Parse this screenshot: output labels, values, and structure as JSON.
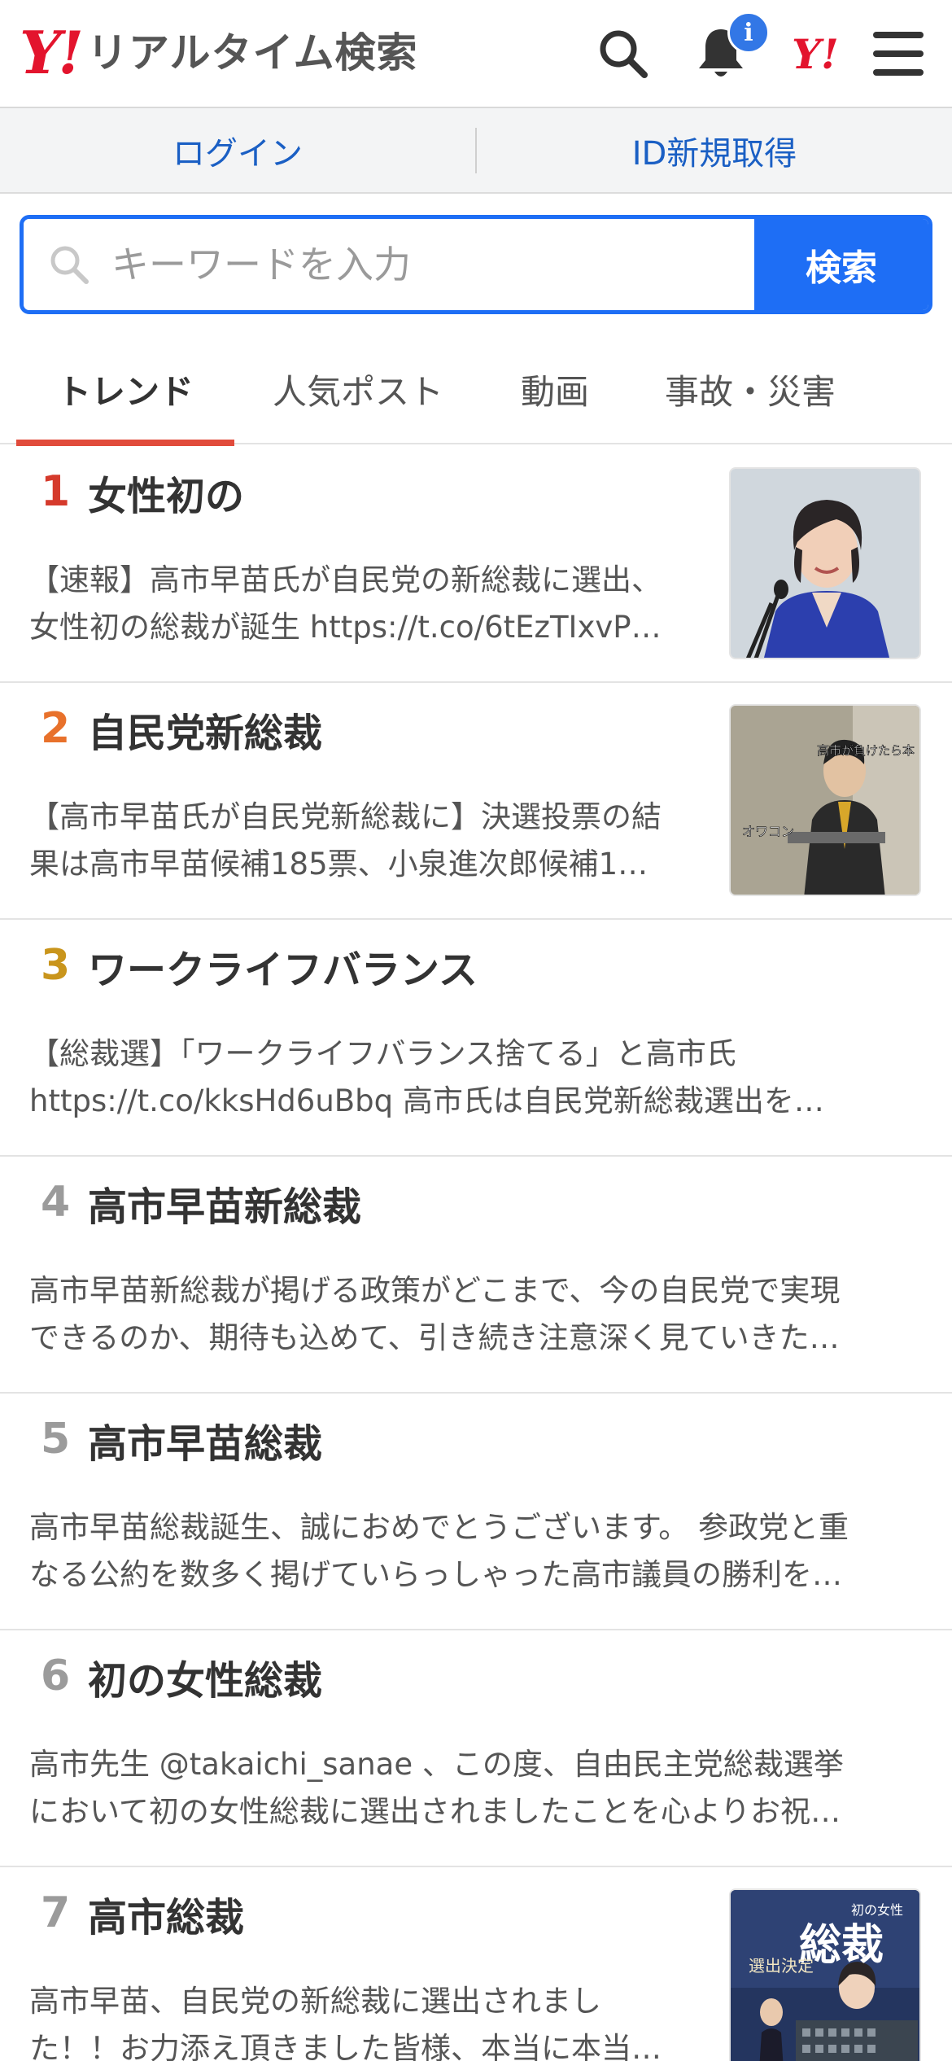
{
  "header": {
    "logo_mark": "Y!",
    "logo_text": "リアルタイム検索",
    "notification_badge": "i",
    "yahoo_mark": "Y!"
  },
  "loginbar": {
    "login_label": "ログイン",
    "register_label": "ID新規取得"
  },
  "search": {
    "placeholder": "キーワードを入力",
    "button_label": "検索"
  },
  "tabs": [
    {
      "label": "トレンド",
      "active": true
    },
    {
      "label": "人気ポスト",
      "active": false
    },
    {
      "label": "動画",
      "active": false
    },
    {
      "label": "事故・災害",
      "active": false
    }
  ],
  "colors": {
    "rank1": "#d53a2c",
    "rank2": "#e8712b",
    "rank3": "#c9951c",
    "rank_other": "#9b9b9b",
    "accent_blue": "#1e6ef5",
    "tab_underline": "#e14b3b"
  },
  "trends": [
    {
      "rank": "1",
      "title": "女性初の",
      "line1": "【速報】高市早苗氏が自民党の新総裁に選出、",
      "line2": "女性初の総裁が誕生 https://t.co/6tEzTIxvP…",
      "has_thumb": true
    },
    {
      "rank": "2",
      "title": "自民党新総裁",
      "line1": "【高市早苗氏が自民党新総裁に】決選投票の結",
      "line2": "果は高市早苗候補185票、小泉進次郎候補1…",
      "has_thumb": true,
      "thumb_texts": [
        "高市が負けたら本",
        "オワコン"
      ]
    },
    {
      "rank": "3",
      "title": "ワークライフバランス",
      "line1": "【総裁選】「ワークライフバランス捨てる」と高市氏",
      "line2": "https://t.co/kksHd6uBbq 高市氏は自民党新総裁選出を…",
      "has_thumb": false
    },
    {
      "rank": "4",
      "title": "高市早苗新総裁",
      "line1": "高市早苗新総裁が掲げる政策がどこまで、今の自民党で実現",
      "line2": "できるのか、期待も込めて、引き続き注意深く見ていきた…",
      "has_thumb": false
    },
    {
      "rank": "5",
      "title": "高市早苗総裁",
      "line1": "高市早苗総裁誕生、誠におめでとうございます。 参政党と重",
      "line2": "なる公約を数多く掲げていらっしゃった高市議員の勝利を…",
      "has_thumb": false
    },
    {
      "rank": "6",
      "title": "初の女性総裁",
      "line1": "高市先生 @takaichi_sanae 、この度、自由民主党総裁選挙",
      "line2": "において初の女性総裁に選出されましたことを心よりお祝…",
      "has_thumb": false
    },
    {
      "rank": "7",
      "title": "高市総裁",
      "line1": "高市早苗、自民党の新総裁に選出されまし",
      "line2": "た！！お力添え頂きました皆様、本当に本当…",
      "has_thumb": true,
      "thumb_texts": [
        "総裁",
        "選出決定",
        "初の女性"
      ]
    }
  ]
}
